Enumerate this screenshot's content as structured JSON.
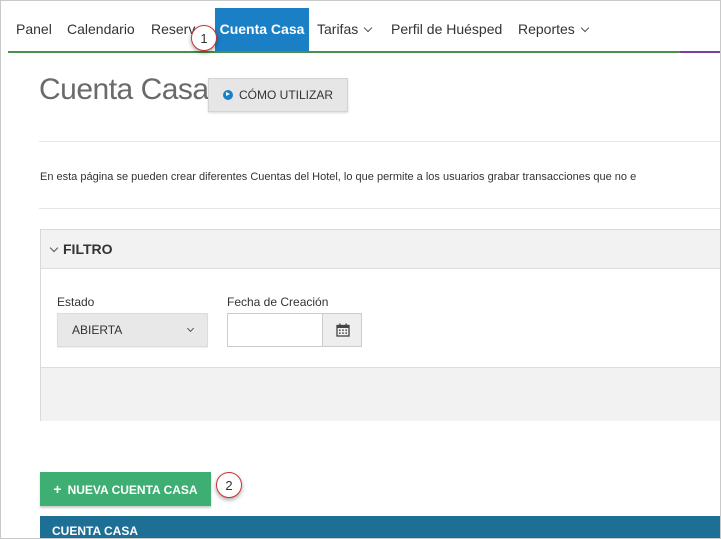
{
  "nav": {
    "items": [
      {
        "label": "Panel"
      },
      {
        "label": "Calendario"
      },
      {
        "label": "Reserv"
      },
      {
        "label": "Cuenta Casa"
      },
      {
        "label": "Tarifas"
      },
      {
        "label": "Perfil de Huésped"
      },
      {
        "label": "Reportes"
      }
    ],
    "active_index": 3,
    "colors": {
      "active_bg": "#1a7fc4",
      "underline": "#4c8f4c"
    }
  },
  "callouts": [
    "1",
    "2"
  ],
  "header": {
    "title": "Cuenta Casa",
    "howto_label": "CÓMO UTILIZAR"
  },
  "description": "En esta página se pueden crear diferentes Cuentas del Hotel, lo que permite a los usuarios grabar transacciones que no e",
  "filter": {
    "title": "FILTRO",
    "estado_label": "Estado",
    "estado_value": "ABIERTA",
    "fecha_label": "Fecha de Creación",
    "fecha_value": ""
  },
  "actions": {
    "new_label": "NUEVA CUENTA CASA",
    "new_color": "#3fae73"
  },
  "table": {
    "header_text": "CUENTA CASA",
    "header_color": "#1e6f96"
  }
}
